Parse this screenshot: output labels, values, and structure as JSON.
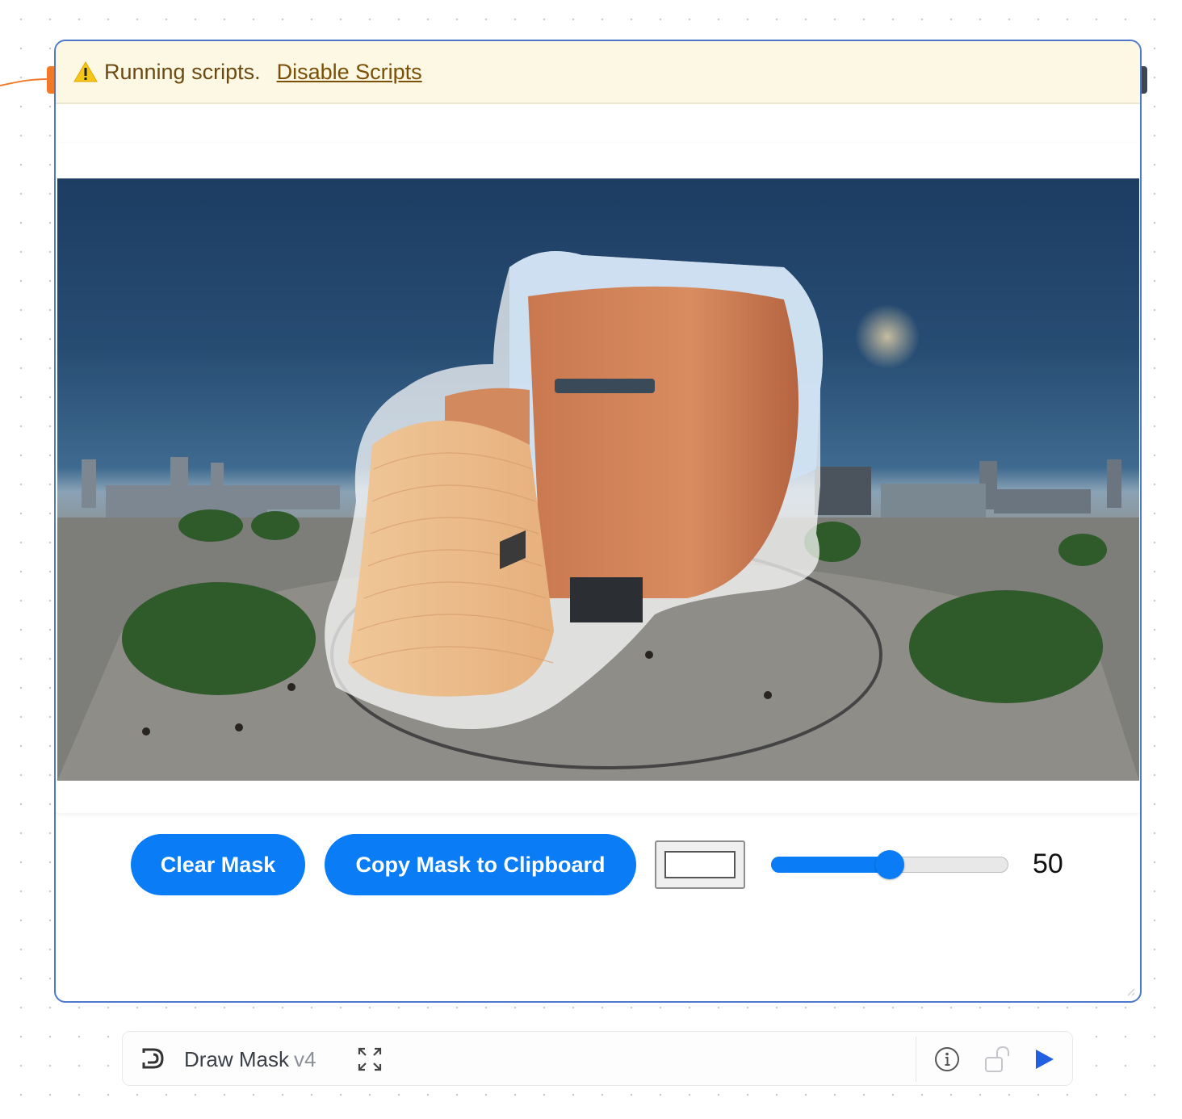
{
  "banner": {
    "icon": "warning-icon",
    "message": "Running scripts.",
    "action_label": "Disable Scripts"
  },
  "canvas": {
    "image": "panorama-with-mask",
    "description_icon": "image-canvas"
  },
  "controls": {
    "clear_label": "Clear Mask",
    "copy_label": "Copy Mask to Clipboard",
    "color_value": "#ffffff",
    "brush_size": "50",
    "brush_size_fraction": 0.5
  },
  "footer": {
    "title": "Draw Mask",
    "version": "v4",
    "icons": [
      "node-logo-icon",
      "expand-icon",
      "info-icon",
      "lock-icon",
      "play-icon"
    ]
  },
  "colors": {
    "accent": "#0a7cf5",
    "node_border": "#4d78cc",
    "banner_bg": "#fdf8e4",
    "connection": "#f07a2a"
  }
}
